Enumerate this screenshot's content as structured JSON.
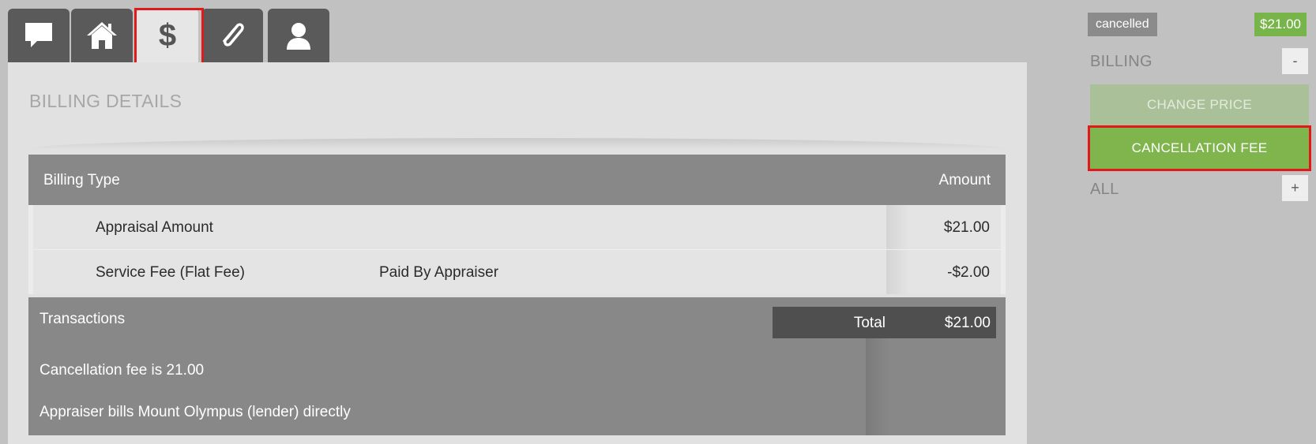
{
  "tabs": [
    {
      "icon": "chat-bubble-icon",
      "active": false
    },
    {
      "icon": "home-icon",
      "active": false
    },
    {
      "icon": "dollar-icon",
      "label": "$",
      "active": true
    },
    {
      "icon": "paperclip-icon",
      "active": false
    },
    {
      "icon": "user-icon",
      "active": false
    }
  ],
  "panel": {
    "title": "BILLING DETAILS"
  },
  "billing_table": {
    "headers": {
      "type": "Billing Type",
      "amount": "Amount"
    },
    "rows": [
      {
        "name": "Appraisal Amount",
        "note": "",
        "amount": "$21.00"
      },
      {
        "name": "Service Fee (Flat Fee)",
        "note": "Paid By Appraiser",
        "amount": "-$2.00"
      }
    ]
  },
  "transactions": {
    "title": "Transactions",
    "total_label": "Total",
    "total_value": "$21.00",
    "lines": [
      "Cancellation fee is 21.00",
      "Appraiser bills Mount Olympus (lender) directly"
    ]
  },
  "sidebar": {
    "status": "cancelled",
    "price": "$21.00",
    "billing_label": "BILLING",
    "billing_toggle": "-",
    "change_price_label": "CHANGE PRICE",
    "cancellation_fee_label": "CANCELLATION FEE",
    "all_label": "ALL",
    "all_toggle": "+"
  },
  "colors": {
    "background": "#c1c1c1",
    "tab_dark": "#5a5a5a",
    "accent_green": "#7fb54c",
    "highlight_red": "#e01a1a"
  }
}
